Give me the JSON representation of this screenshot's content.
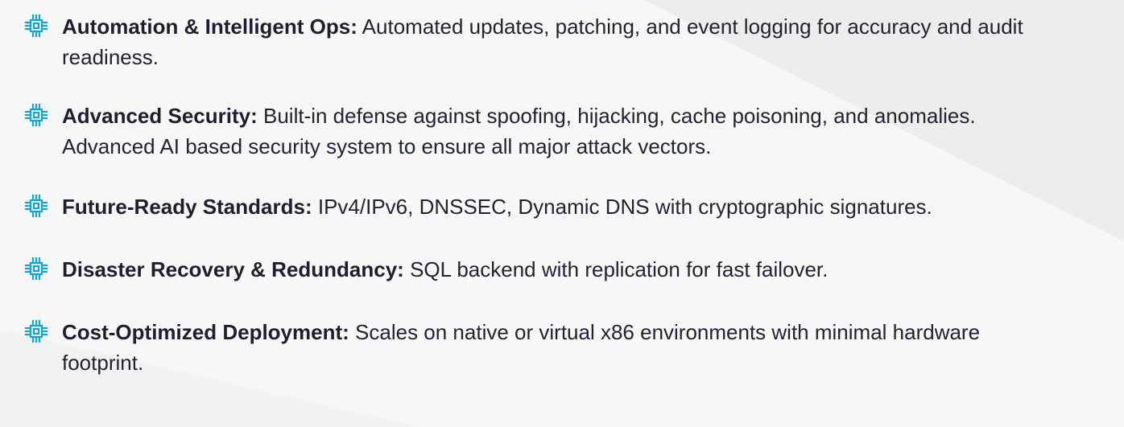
{
  "features": [
    {
      "icon": "cpu-chip-icon",
      "title": "Automation & Intelligent Ops:",
      "description": "Automated updates, patching, and event logging for accuracy and audit readiness."
    },
    {
      "icon": "cpu-chip-icon",
      "title": "Advanced Security:",
      "description": "Built-in defense against spoofing, hijacking, cache poisoning, and anomalies. Advanced AI based security system to ensure all major attack vectors."
    },
    {
      "icon": "cpu-chip-icon",
      "title": "Future-Ready Standards:",
      "description": "IPv4/IPv6, DNSSEC, Dynamic DNS with cryptographic signatures."
    },
    {
      "icon": "cpu-chip-icon",
      "title": "Disaster Recovery & Redundancy:",
      "description": "SQL backend with replication for fast failover."
    },
    {
      "icon": "cpu-chip-icon",
      "title": "Cost-Optimized Deployment:",
      "description": "Scales on native or virtual x86 environments with minimal hardware footprint."
    }
  ],
  "colors": {
    "icon": "#1aa3c8",
    "text": "#1f2330",
    "background": "#f2f2f3",
    "background_shape": "#f8f8f9"
  }
}
